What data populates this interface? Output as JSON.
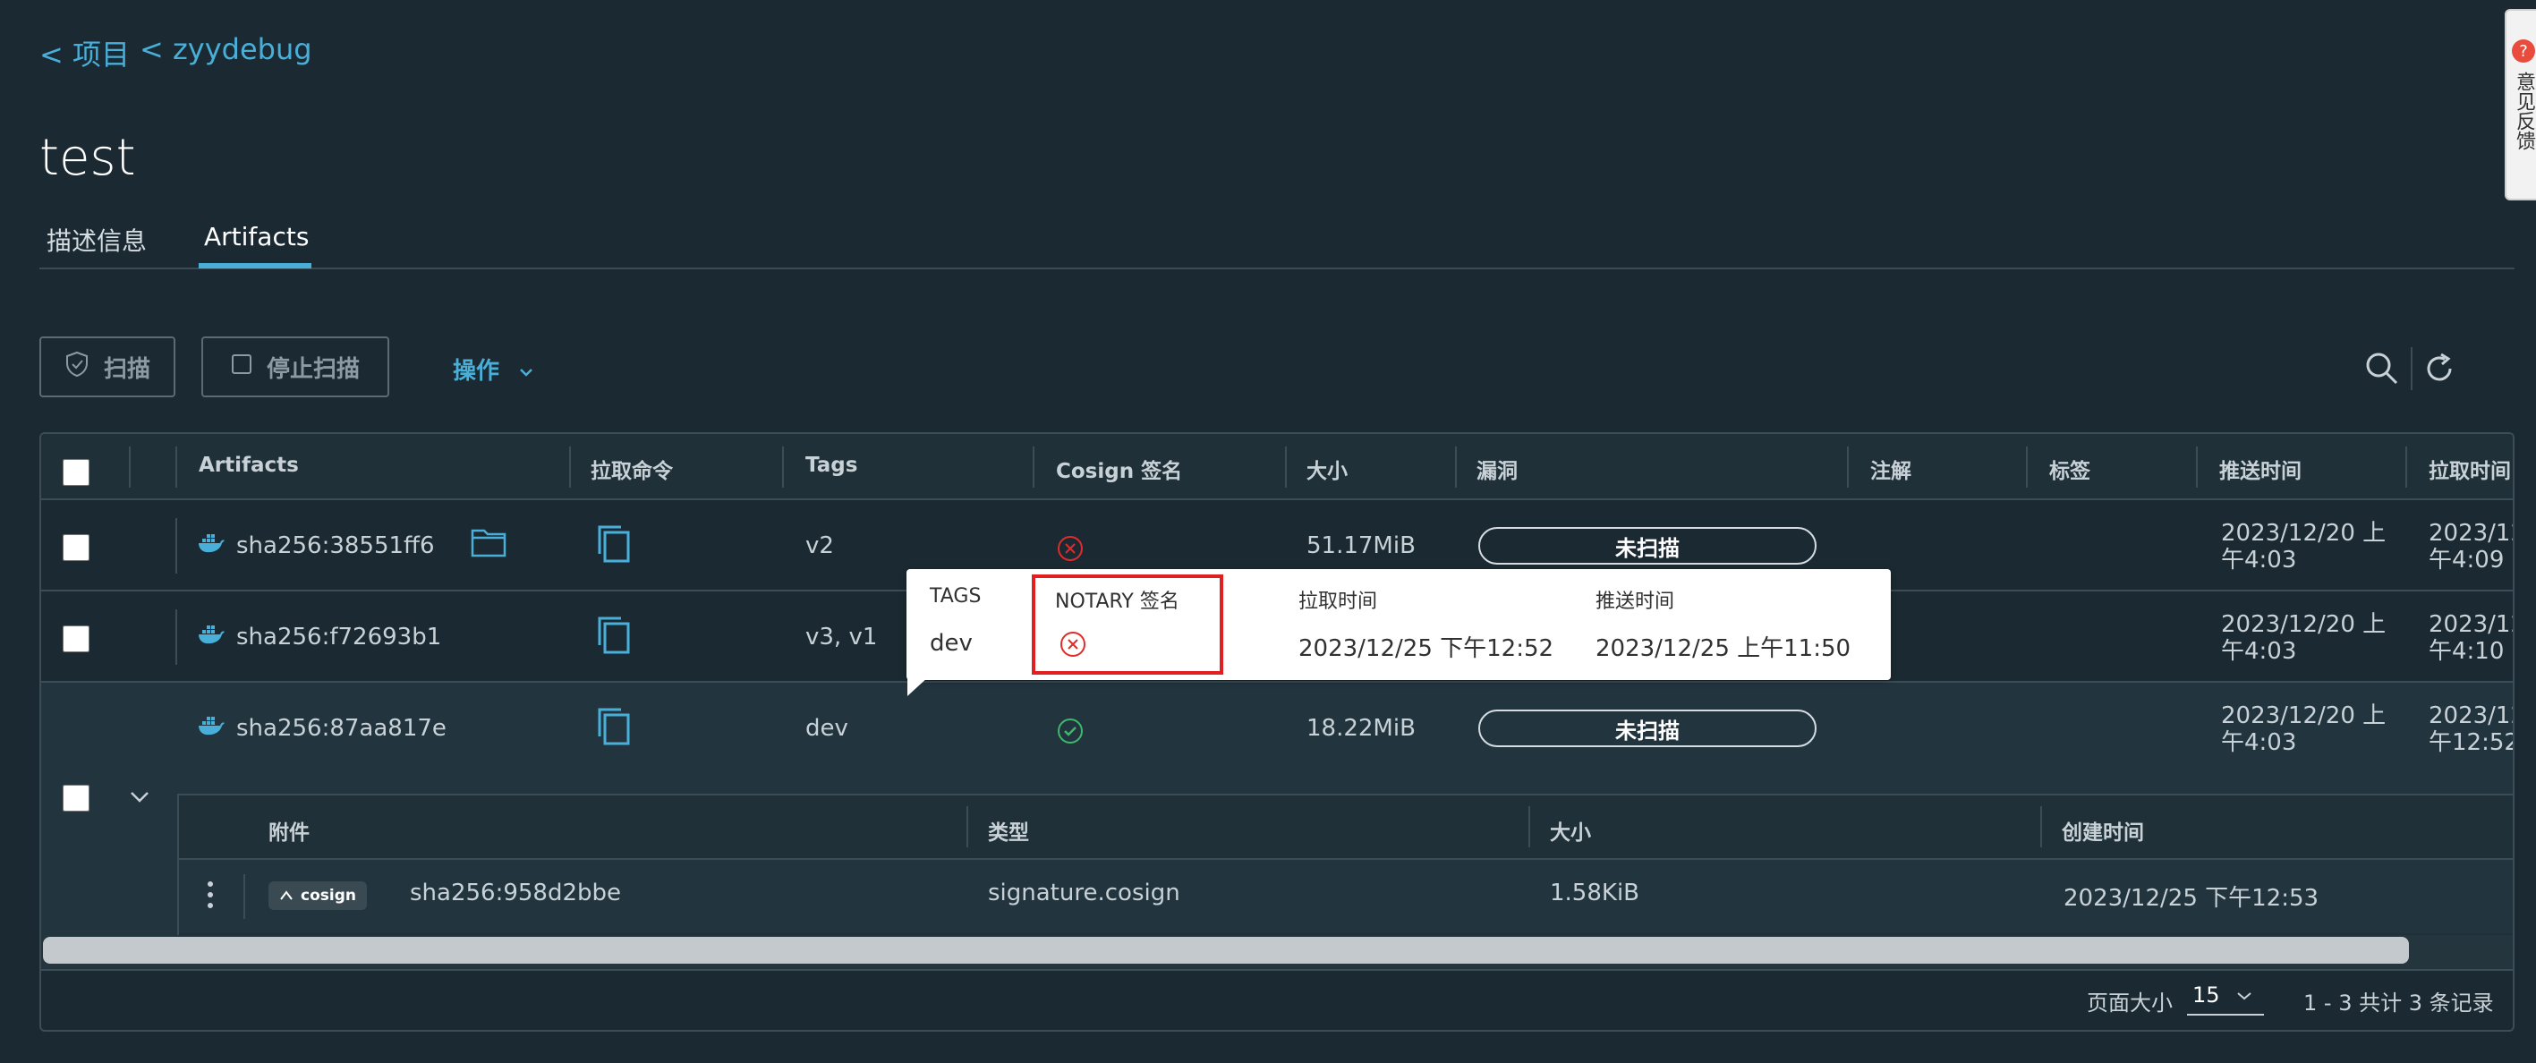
{
  "breadcrumb": [
    {
      "label": "< 项目"
    },
    {
      "label": "< zyydebug"
    }
  ],
  "page_title": "test",
  "tabs": [
    {
      "label": "描述信息",
      "active": false
    },
    {
      "label": "Artifacts",
      "active": true
    }
  ],
  "toolbar": {
    "scan_label": "扫描",
    "stop_scan_label": "停止扫描",
    "actions_label": "操作"
  },
  "columns": [
    "Artifacts",
    "拉取命令",
    "Tags",
    "Cosign 签名",
    "大小",
    "漏洞",
    "注解",
    "标签",
    "推送时间",
    "拉取时间"
  ],
  "rows": [
    {
      "digest": "sha256:38551ff6",
      "tags": "v2",
      "cosign": "unsigned",
      "size": "51.17MiB",
      "vuln": "未扫描",
      "push_time_1": "2023/12/20 上",
      "push_time_2": "午4:03",
      "pull_time_1": "2023/12",
      "pull_time_2": "午4:09"
    },
    {
      "digest": "sha256:f72693b1",
      "tags": "v3, v1",
      "cosign": "unsigned",
      "size": "",
      "vuln": "",
      "push_time_1": "2023/12/20 上",
      "push_time_2": "午4:03",
      "pull_time_1": "2023/12",
      "pull_time_2": "午4:10"
    },
    {
      "digest": "sha256:87aa817e",
      "tags": "dev",
      "cosign": "signed",
      "size": "18.22MiB",
      "vuln": "未扫描",
      "push_time_1": "2023/12/20 上",
      "push_time_2": "午4:03",
      "pull_time_1": "2023/12",
      "pull_time_2": "午12:52"
    }
  ],
  "accessory": {
    "columns": [
      "附件",
      "类型",
      "大小",
      "创建时间"
    ],
    "badge": "cosign",
    "digest": "sha256:958d2bbe",
    "type": "signature.cosign",
    "size": "1.58KiB",
    "created": "2023/12/25 下午12:53"
  },
  "popup": {
    "headers": [
      "TAGS",
      "NOTARY 签名",
      "拉取时间",
      "推送时间"
    ],
    "tag": "dev",
    "notary": "unsigned",
    "pull_time": "2023/12/25 下午12:52",
    "push_time": "2023/12/25 上午11:50"
  },
  "pagination": {
    "page_size_label": "页面大小",
    "page_size": "15",
    "summary": "1 - 3 共计 3 条记录"
  },
  "side_tab": {
    "text": "意见反馈",
    "badge": "?"
  },
  "colors": {
    "accent": "#49afd9",
    "error": "#e02b2b",
    "success": "#3db86b",
    "highlight": "#e02020"
  }
}
